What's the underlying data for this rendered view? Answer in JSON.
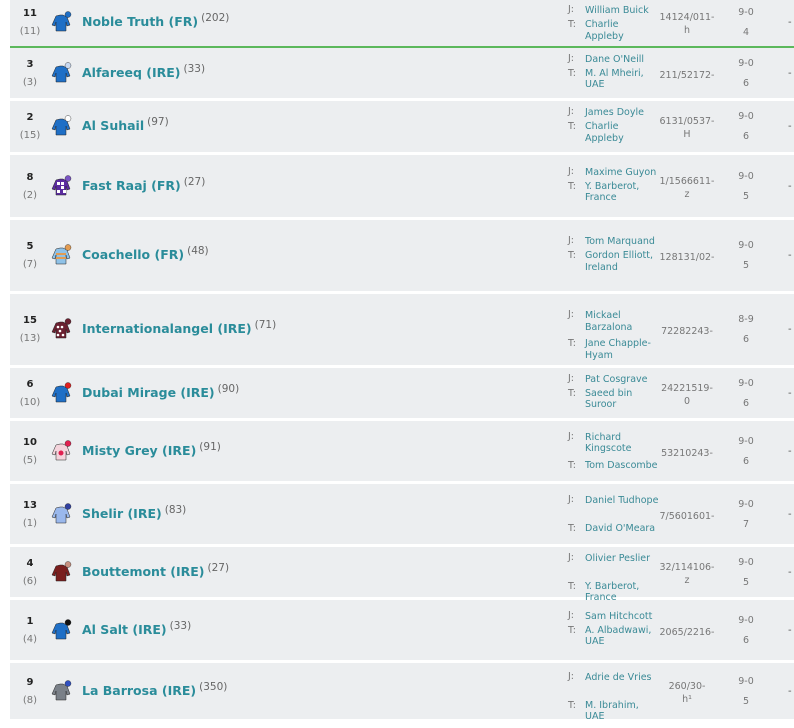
{
  "runners": [
    {
      "num": "11",
      "draw": "(11)",
      "name": "Noble Truth (FR)",
      "rating": "(202)",
      "jockey": "William Buick",
      "trainer": "Charlie Appleby",
      "form": "14124/011-",
      "form2": "h",
      "weight": "9-0",
      "age": "4",
      "dash": "-",
      "silk": {
        "body": "#1f6fc6",
        "cap": "#1f6fc6",
        "accent": "#1f6fc6",
        "pattern": "plain"
      }
    },
    {
      "num": "3",
      "draw": "(3)",
      "name": "Alfareeq (IRE)",
      "rating": "(33)",
      "jockey": "Dane O'Neill",
      "trainer": "M. Al Mheiri, UAE",
      "form": "211/52172-",
      "form2": "",
      "weight": "9-0",
      "age": "6",
      "dash": "-",
      "silk": {
        "body": "#1f6fc6",
        "cap": "#c8d8f0",
        "accent": "#ffffff",
        "pattern": "plain"
      }
    },
    {
      "num": "2",
      "draw": "(15)",
      "name": "Al Suhail",
      "rating": "(97)",
      "jockey": "James Doyle",
      "trainer": "Charlie Appleby",
      "form": "6131/0537-",
      "form2": "H",
      "weight": "9-0",
      "age": "6",
      "dash": "-",
      "silk": {
        "body": "#1f6fc6",
        "cap": "#ffffff",
        "accent": "#1f6fc6",
        "pattern": "plain"
      }
    },
    {
      "num": "8",
      "draw": "(2)",
      "name": "Fast Raaj (FR)",
      "rating": "(27)",
      "jockey": "Maxime Guyon",
      "trainer": "Y. Barberot, France",
      "form": "1/1566611-",
      "form2": "z",
      "weight": "9-0",
      "age": "5",
      "dash": "-",
      "silk": {
        "body": "#5b2ca0",
        "cap": "#7a54c4",
        "accent": "#ffffff",
        "pattern": "check"
      }
    },
    {
      "num": "5",
      "draw": "(7)",
      "name": "Coachello (FR)",
      "rating": "(48)",
      "jockey": "Tom Marquand",
      "trainer": "Gordon Elliott, Ireland",
      "form": "128131/02-",
      "form2": "",
      "weight": "9-0",
      "age": "5",
      "dash": "-",
      "silk": {
        "body": "#8fc2e8",
        "cap": "#e39c52",
        "accent": "#e39c52",
        "pattern": "stripe"
      }
    },
    {
      "num": "15",
      "draw": "(13)",
      "name": "Internationalangel (IRE)",
      "rating": "(71)",
      "jockey": "Mickael Barzalona",
      "trainer": "Jane Chapple-Hyam",
      "form": "72282243-",
      "form2": "",
      "weight": "8-9",
      "age": "6",
      "dash": "-",
      "silk": {
        "body": "#6a2030",
        "cap": "#6a2030",
        "accent": "#ffffff",
        "pattern": "spots"
      }
    },
    {
      "num": "6",
      "draw": "(10)",
      "name": "Dubai Mirage (IRE)",
      "rating": "(90)",
      "jockey": "Pat Cosgrave",
      "trainer": "Saeed bin Suroor",
      "form": "24221519-",
      "form2": "0",
      "weight": "9-0",
      "age": "6",
      "dash": "-",
      "silk": {
        "body": "#1f6fc6",
        "cap": "#e02020",
        "accent": "#1f6fc6",
        "pattern": "plain"
      }
    },
    {
      "num": "10",
      "draw": "(5)",
      "name": "Misty Grey (IRE)",
      "rating": "(91)",
      "jockey": "Richard Kingscote",
      "trainer": "Tom Dascombe",
      "form": "53210243-",
      "form2": "",
      "weight": "9-0",
      "age": "6",
      "dash": "-",
      "silk": {
        "body": "#f4d4dc",
        "cap": "#e02050",
        "accent": "#e02050",
        "pattern": "disc"
      }
    },
    {
      "num": "13",
      "draw": "(1)",
      "name": "Shelir (IRE)",
      "rating": "(83)",
      "jockey": "Daniel Tudhope",
      "trainer": "David O'Meara",
      "form": "7/5601601-",
      "form2": "",
      "weight": "9-0",
      "age": "7",
      "dash": "-",
      "silk": {
        "body": "#9ab8ec",
        "cap": "#3040a0",
        "accent": "#3040a0",
        "pattern": "plain"
      }
    },
    {
      "num": "4",
      "draw": "(6)",
      "name": "Bouttemont (IRE)",
      "rating": "(27)",
      "jockey": "Olivier Peslier",
      "trainer": "Y. Barberot, France",
      "form": "32/114106-",
      "form2": "z",
      "weight": "9-0",
      "age": "5",
      "dash": "-",
      "silk": {
        "body": "#7a1e1e",
        "cap": "#c89080",
        "accent": "#c89080",
        "pattern": "plain"
      }
    },
    {
      "num": "1",
      "draw": "(4)",
      "name": "Al Salt (IRE)",
      "rating": "(33)",
      "jockey": "Sam Hitchcott",
      "trainer": "A. Albadwawi, UAE",
      "form": "2065/2216-",
      "form2": "",
      "weight": "9-0",
      "age": "6",
      "dash": "-",
      "silk": {
        "body": "#1f6fc6",
        "cap": "#111111",
        "accent": "#1f6fc6",
        "pattern": "plain"
      }
    },
    {
      "num": "9",
      "draw": "(8)",
      "name": "La Barrosa (IRE)",
      "rating": "(350)",
      "jockey": "Adrie de Vries",
      "trainer": "M. Ibrahim, UAE",
      "form": "260/30-",
      "form2": "h¹",
      "weight": "9-0",
      "age": "5",
      "dash": "-",
      "silk": {
        "body": "#7a8088",
        "cap": "#3050c0",
        "accent": "#3050c0",
        "pattern": "plain"
      }
    }
  ],
  "labels": {
    "jockey_prefix": "J:",
    "trainer_prefix": "T:"
  }
}
